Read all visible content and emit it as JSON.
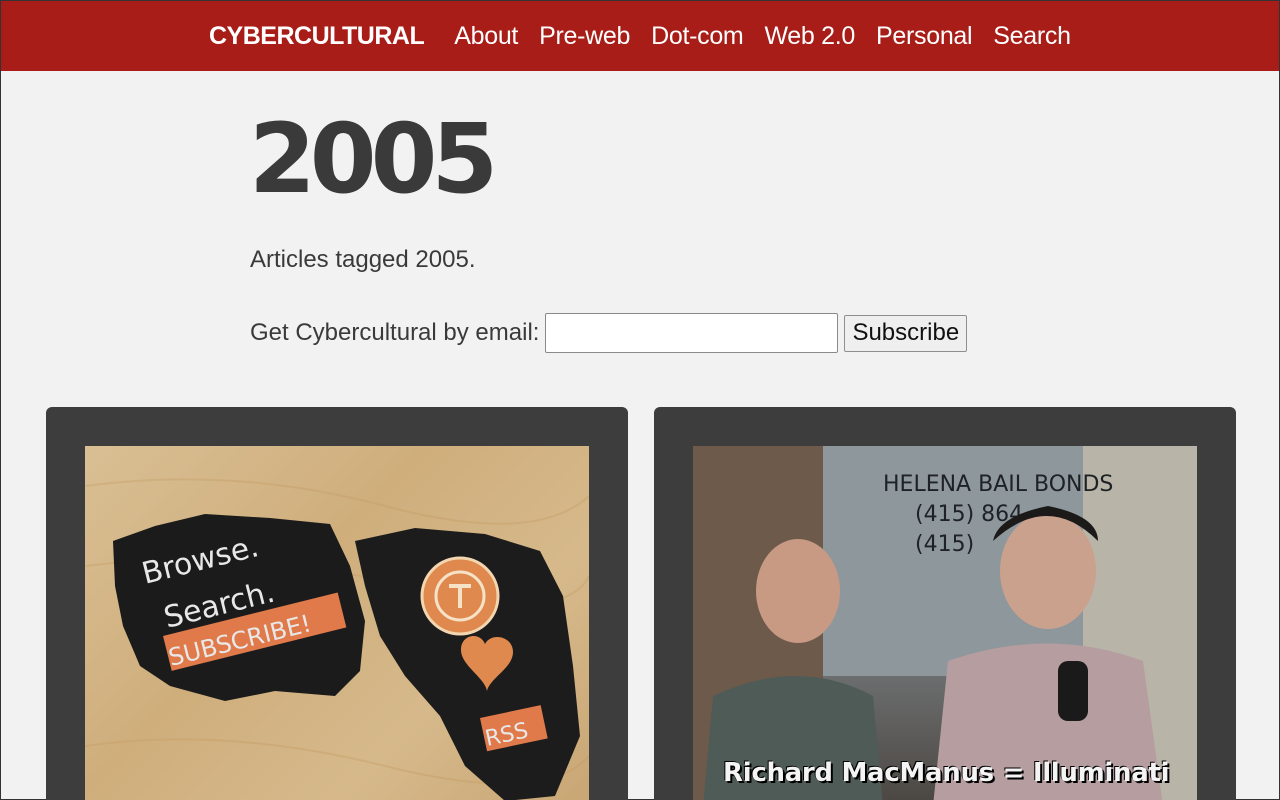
{
  "header": {
    "brand": "CYBERCULTURAL",
    "nav": [
      "About",
      "Pre-web",
      "Dot-com",
      "Web 2.0",
      "Personal",
      "Search"
    ]
  },
  "main": {
    "title": "2005",
    "description": "Articles tagged 2005.",
    "subscribe": {
      "label": "Get Cybercultural by email:",
      "input_value": "",
      "button_label": "Subscribe"
    }
  },
  "cards": [
    {
      "image_text": [
        "Browse.",
        "Search.",
        "SUBSCRIBE!",
        "RSS"
      ]
    },
    {
      "image_text": [
        "HELENA BAIL BONDS",
        "(415) 864",
        "(415)",
        "Richard MacManus = Illuminati"
      ]
    }
  ],
  "colors": {
    "header_bg": "#a81d17",
    "page_bg": "#f2f2f2",
    "card_bg": "#3d3d3d"
  }
}
